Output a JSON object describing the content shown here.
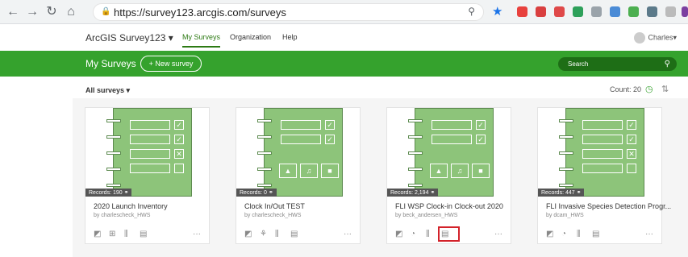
{
  "browser": {
    "url": "https://survey123.arcgis.com/surveys"
  },
  "app": {
    "brand": "ArcGIS Survey123",
    "brand_caret": "▾",
    "nav": [
      "My Surveys",
      "Organization",
      "Help"
    ],
    "user": "Charles"
  },
  "toolbar": {
    "title": "My Surveys",
    "new_button": "+ New survey",
    "search_placeholder": "Search"
  },
  "filter": {
    "label": "All surveys",
    "count_label": "Count: 20"
  },
  "colors": {
    "accent": "#35a22d",
    "highlight": "#d3222a"
  },
  "cards": [
    {
      "records": "Records: 190",
      "title": "2020 Launch Inventory",
      "owner": "by charlescheck_HWS",
      "thumb": "form"
    },
    {
      "records": "Records: 0",
      "title": "Clock In/Out TEST",
      "owner": "by charlescheck_HWS",
      "thumb": "media"
    },
    {
      "records": "Records: 2,194",
      "title": "FLI WSP Clock-in Clock-out 2020",
      "owner": "by beck_andersen_HWS",
      "thumb": "media"
    },
    {
      "records": "Records: 447",
      "title": "FLI Invasive Species Detection Progr...",
      "owner": "by dcam_HWS",
      "thumb": "form"
    }
  ]
}
